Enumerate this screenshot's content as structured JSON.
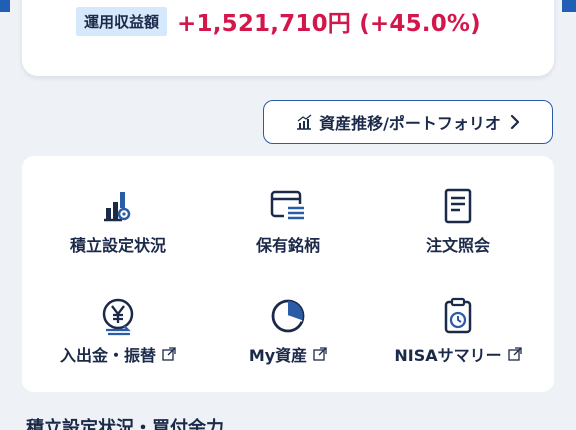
{
  "summary": {
    "gain_label": "運用収益額",
    "gain_value": "+1,521,710円 (+45.0%)"
  },
  "asset_button": {
    "label": "資産推移/ポートフォリオ"
  },
  "menu": [
    {
      "label": "積立設定状況",
      "icon": "chart-gear-icon",
      "external": false
    },
    {
      "label": "保有銘柄",
      "icon": "card-list-icon",
      "external": false
    },
    {
      "label": "注文照会",
      "icon": "document-icon",
      "external": false
    },
    {
      "label": "入出金・振替",
      "icon": "yen-transfer-icon",
      "external": true
    },
    {
      "label": "My資産",
      "icon": "pie-chart-icon",
      "external": true
    },
    {
      "label": "NISAサマリー",
      "icon": "clipboard-clock-icon",
      "external": true
    }
  ],
  "section": {
    "title": "積立設定状況・買付余力"
  },
  "colors": {
    "navy": "#1c2a4a",
    "accent_blue": "#2b5ca8",
    "gain_red": "#d3174b",
    "label_bg": "#d6e8fb"
  }
}
